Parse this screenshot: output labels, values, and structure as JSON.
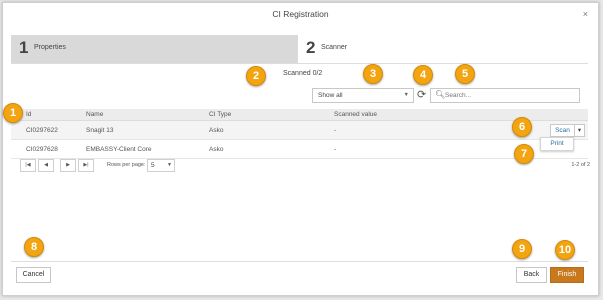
{
  "dialog": {
    "title": "CI Registration",
    "close_glyph": "×"
  },
  "steps": [
    {
      "number": "1",
      "label": "Properties"
    },
    {
      "number": "2",
      "label": "Scanner"
    }
  ],
  "scanner": {
    "status": "Scanned 0/2",
    "filter": {
      "selected": "Show all",
      "arrow": "▼"
    },
    "refresh_glyph": "⟳",
    "search": {
      "icon_glyph": "🔍︎",
      "placeholder": "Search..."
    }
  },
  "table": {
    "columns": [
      "Id",
      "Name",
      "CI Type",
      "Scanned value"
    ],
    "rows": [
      {
        "id": "CI0297622",
        "name": "Snagit 13",
        "ci_type": "Asko",
        "scanned_value": "-"
      },
      {
        "id": "CI0297628",
        "name": "EMBASSY-Client Core",
        "ci_type": "Asko",
        "scanned_value": "-"
      }
    ],
    "row_action": {
      "scan_label": "Scan",
      "caret": "▾",
      "menu_item": "Print"
    }
  },
  "pagination": {
    "first": "|◀",
    "prev": "◀",
    "next": "▶",
    "last": "▶|",
    "rows_per_page_label": "Rows per page:",
    "rows_per_page_value": "5",
    "rows_arrow": "▼",
    "range_text": "1-2 of 2"
  },
  "footer": {
    "cancel": "Cancel",
    "back": "Back",
    "finish": "Finish"
  },
  "callouts": [
    "1",
    "2",
    "3",
    "4",
    "5",
    "6",
    "7",
    "8",
    "9",
    "10"
  ],
  "colors": {
    "accent": "#c8781d",
    "callout": "#f2a411",
    "link": "#2a6f9e"
  },
  "icons": {
    "refresh": "refresh-icon",
    "search": "search-icon",
    "close": "close-icon",
    "pager_first": "first-page-icon",
    "pager_prev": "previous-page-icon",
    "pager_next": "next-page-icon",
    "pager_last": "last-page-icon"
  }
}
